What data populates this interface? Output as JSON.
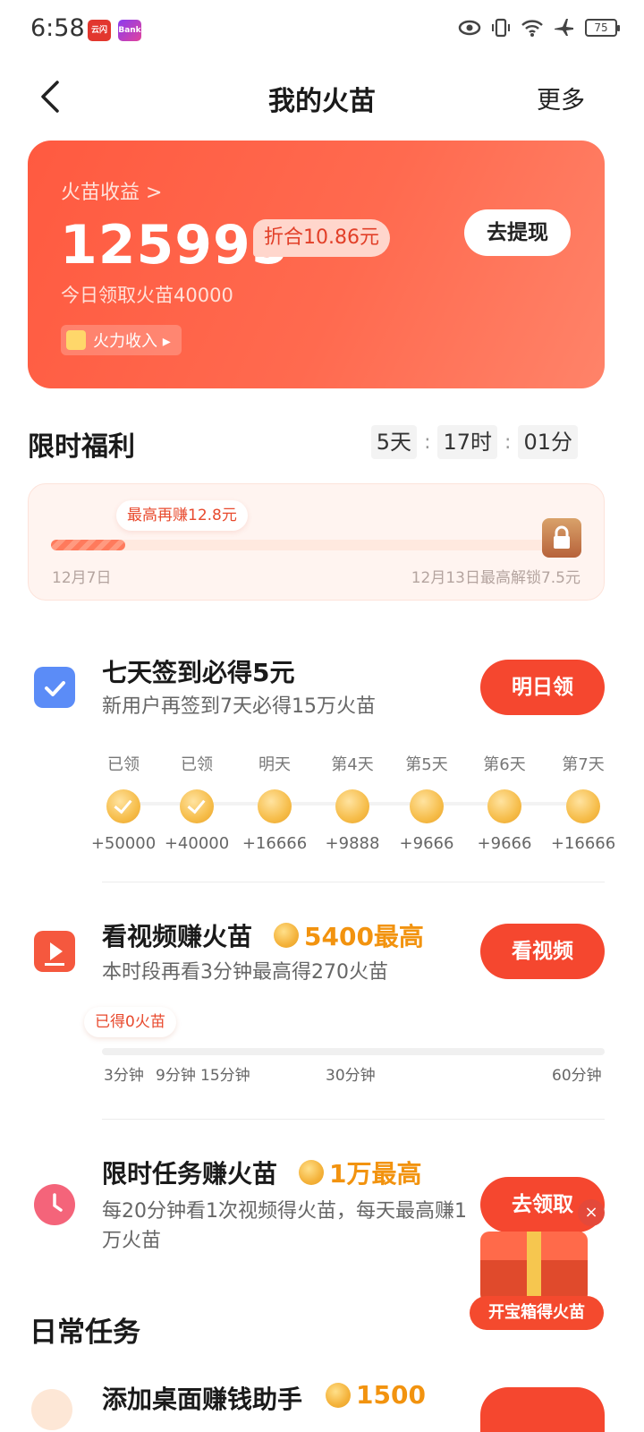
{
  "status_bar": {
    "time": "6:58",
    "battery": "75",
    "badge_a": "云闪付",
    "badge_b": "Bank"
  },
  "nav": {
    "title": "我的火苗",
    "more": "更多"
  },
  "earnings": {
    "label": "火苗收益 >",
    "amount": "125995",
    "converted": "折合10.86元",
    "withdraw": "去提现",
    "today": "今日领取火苗40000",
    "power_income": "火力收入 ▸"
  },
  "welfare": {
    "title": "限时福利",
    "countdown": {
      "days": "5天",
      "hours": "17时",
      "minutes": "01分",
      "sep": ":"
    },
    "tip": "最高再赚12.8元",
    "progress": 0.15,
    "start": "12月7日",
    "end": "12月13日最高解锁7.5元"
  },
  "tasks": {
    "signin": {
      "title": "七天签到必得5元",
      "desc": "新用户再签到7天必得15万火苗",
      "button": "明日领",
      "days": [
        {
          "label": "已领",
          "value": "+50000",
          "done": true
        },
        {
          "label": "已领",
          "value": "+40000",
          "done": true
        },
        {
          "label": "明天",
          "value": "+16666",
          "done": false
        },
        {
          "label": "第4天",
          "value": "+9888",
          "done": false
        },
        {
          "label": "第5天",
          "value": "+9666",
          "done": false
        },
        {
          "label": "第6天",
          "value": "+9666",
          "done": false
        },
        {
          "label": "第7天",
          "value": "+16666",
          "done": false
        }
      ]
    },
    "video": {
      "title": "看视频赚火苗",
      "reward": "5400最高",
      "desc": "本时段再看3分钟最高得270火苗",
      "button": "看视频",
      "earned_tip": "已得0火苗",
      "progress": 0,
      "marks": [
        "3分钟",
        "9分钟",
        "15分钟",
        "30分钟",
        "60分钟"
      ]
    },
    "limited": {
      "title": "限时任务赚火苗",
      "reward": "1万最高",
      "desc": "每20分钟看1次视频得火苗，每天最高赚1万火苗",
      "button": "去领取"
    }
  },
  "daily": {
    "title": "日常任务",
    "partial_task": "添加桌面赚钱助手",
    "partial_reward": "1500"
  },
  "chest": {
    "label": "开宝箱得火苗",
    "close": "×"
  },
  "colors": {
    "primary": "#f5472f",
    "reward": "#f2930f",
    "card_start": "#ff5a40",
    "card_end": "#ff8369"
  }
}
